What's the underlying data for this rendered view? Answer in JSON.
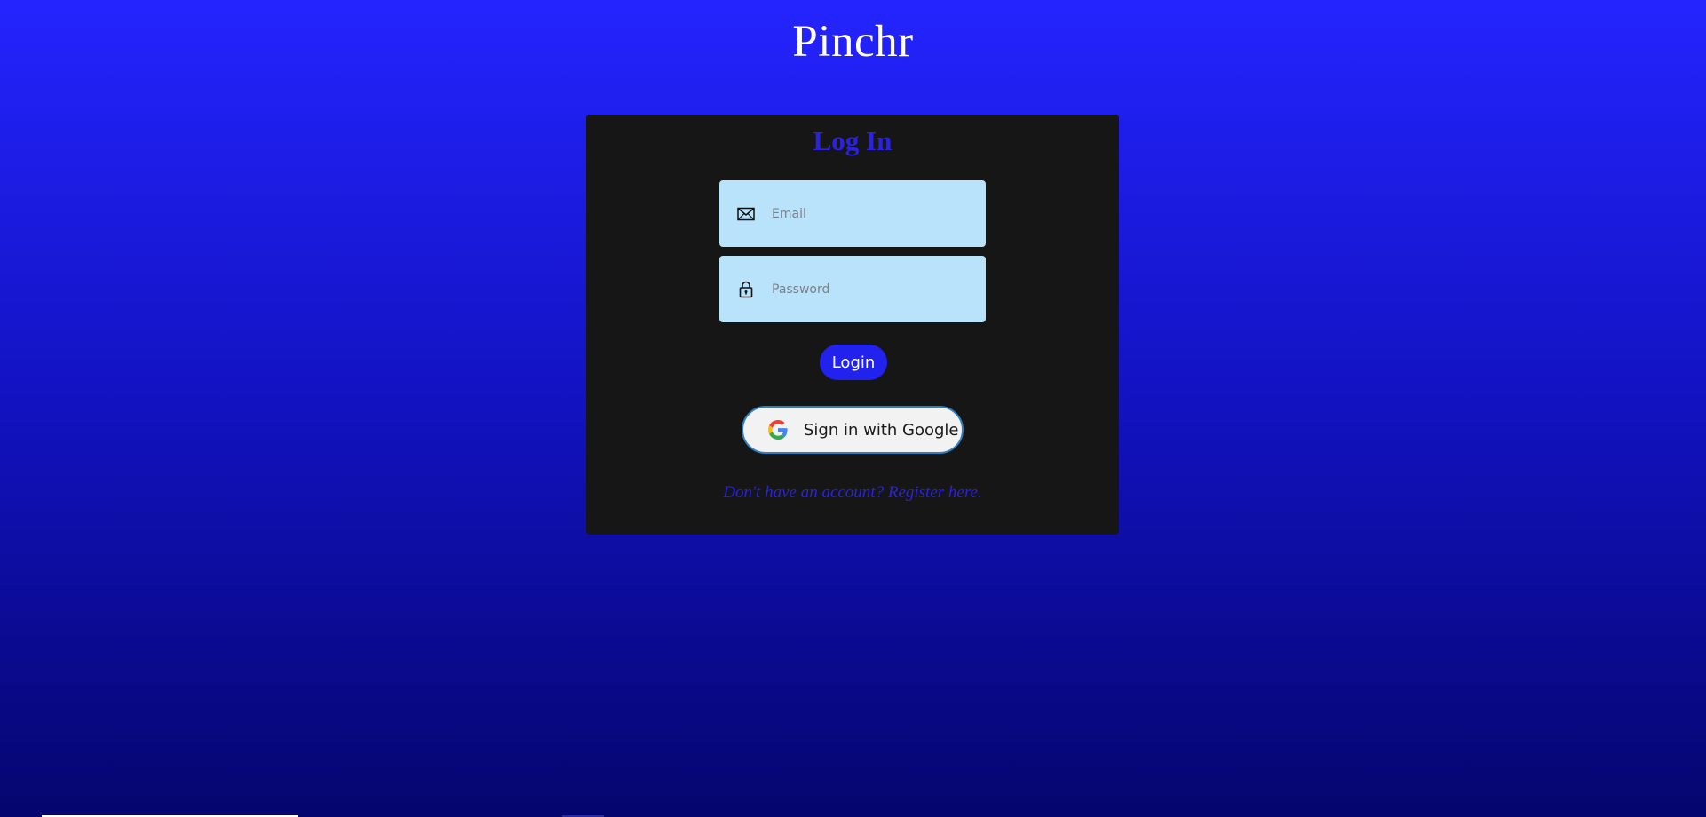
{
  "app": {
    "title": "Pinchr"
  },
  "login_card": {
    "heading": "Log In",
    "email_field": {
      "placeholder": "Email",
      "value": "",
      "icon": "envelope-icon"
    },
    "password_field": {
      "placeholder": "Password",
      "value": "",
      "icon": "lock-icon"
    },
    "login_button_label": "Login",
    "google_button": {
      "label": "Sign in with Google",
      "icon": "google-icon"
    },
    "register_link": "Don't have an account? Register here."
  },
  "colors": {
    "background_top": "#2424ff",
    "background_bottom": "#05056e",
    "card_background": "#171617",
    "accent": "#2a22e0",
    "field_background": "#b9e3fb",
    "google_border": "#2f7fc0"
  }
}
